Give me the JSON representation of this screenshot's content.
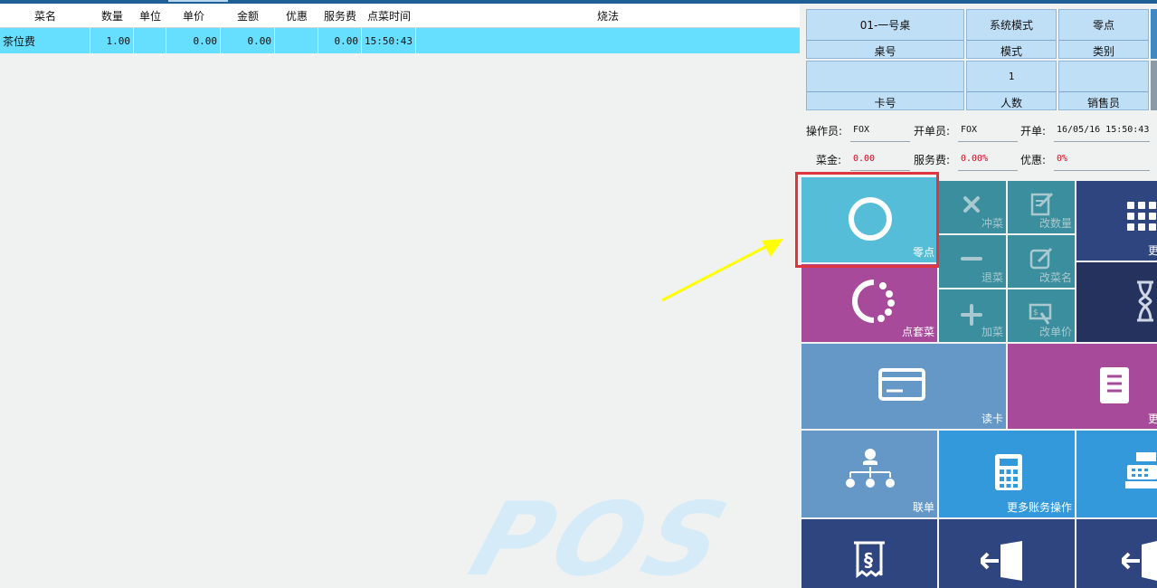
{
  "order_table": {
    "headers": {
      "name": "菜名",
      "qty": "数量",
      "unit": "单位",
      "price": "单价",
      "amount": "金额",
      "discount": "优惠",
      "service_fee": "服务费",
      "order_time": "点菜时间",
      "method": "烧法"
    },
    "rows": [
      {
        "name": "茶位费",
        "qty": "1.00",
        "unit": "",
        "price": "0.00",
        "amount": "0.00",
        "discount": "",
        "service_fee": "0.00",
        "order_time": "15:50:43",
        "method": ""
      }
    ]
  },
  "watermark": "POS",
  "table_info": {
    "table_no": {
      "value": "01-一号桌",
      "label": "桌号"
    },
    "mode": {
      "value": "系统模式",
      "label": "模式"
    },
    "category": {
      "value": "零点",
      "label": "类别"
    },
    "card_no": {
      "value": "",
      "label": "卡号"
    },
    "guests": {
      "value": "1",
      "label": "人数"
    },
    "salesperson": {
      "value": "",
      "label": "销售员"
    }
  },
  "staff_info": {
    "operator_label": "操作员:",
    "operator": "FOX",
    "opener_label": "开单员:",
    "opener": "FOX",
    "open_time_label": "开单:",
    "open_time": "16/05/16 15:50:43",
    "food_amount_label": "菜金:",
    "food_amount": "0.00",
    "service_fee_label": "服务费:",
    "service_fee": "0.00%",
    "discount_label": "优惠:",
    "discount": "0%"
  },
  "tiles": {
    "a_la_carte": "零点",
    "cancel_dish": "冲菜",
    "change_qty": "改数量",
    "return_dish": "退菜",
    "rename_dish": "改菜名",
    "add_dish": "加菜",
    "change_price": "改单价",
    "set_meal": "点套菜",
    "more_top": "更",
    "read_card": "读卡",
    "more_mid": "更",
    "join_bill": "联单",
    "more_account_ops": "更多账务操作"
  },
  "colors": {
    "selected_row": "#66dfff",
    "info_cell": "#bfdff6",
    "tile_cyan": "#55bdd7",
    "tile_purple": "#a74a99",
    "tile_teal": "#3a8e9d",
    "tile_navy": "#2f457f",
    "tile_steel": "#6598c6",
    "tile_blue": "#3399db",
    "highlight_box": "#e0343e",
    "annotation_arrow": "#ffff00",
    "value_red": "#e4001b"
  },
  "icons": {
    "a_la_carte": "circle-icon",
    "cancel_dish": "x-icon",
    "change_qty": "edit-doc-icon",
    "return_dish": "minus-icon",
    "rename_dish": "edit-icon",
    "add_dish": "plus-icon",
    "change_price": "price-tag-icon",
    "set_meal": "dotted-ring-icon",
    "more_top": "grid-icon",
    "hourglass": "hourglass-icon",
    "read_card": "card-icon",
    "more_mid": "document-icon",
    "join_bill": "hierarchy-icon",
    "more_account_ops": "calculator-icon",
    "cash_register": "cash-register-icon",
    "bill": "receipt-icon",
    "exit_1": "exit-door-icon",
    "exit_2": "exit-door-icon"
  }
}
